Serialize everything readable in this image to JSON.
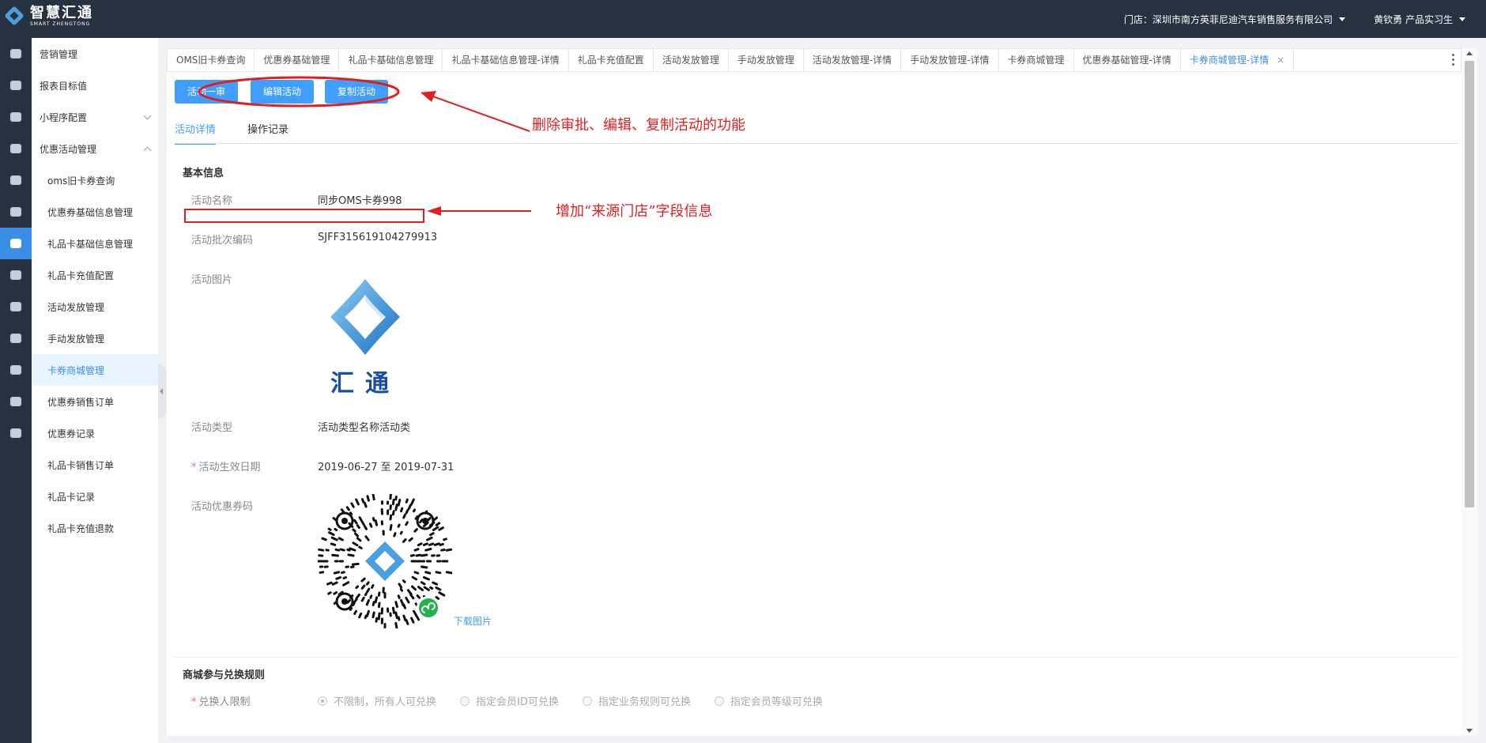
{
  "header": {
    "logo_cn": "智慧汇通",
    "logo_en": "SMART ZHENGTONG",
    "store": "门店：深圳市南方英菲尼迪汽车销售服务有限公司",
    "user": "黄钦勇 产品实习生"
  },
  "rail": {
    "icons": [
      "users-icon",
      "car-icon",
      "gear-icon",
      "shield-icon",
      "crown-icon",
      "database-icon",
      "ticket-icon",
      "calendar-icon",
      "pie-chart-icon",
      "cube-icon",
      "briefcase-icon",
      "person-icon",
      "printer-icon"
    ],
    "active_index": 6
  },
  "menu": {
    "items": [
      {
        "label": "营销管理",
        "level": 0
      },
      {
        "label": "报表目标值",
        "level": 0
      },
      {
        "label": "小程序配置",
        "level": 0,
        "chevron": "down"
      },
      {
        "label": "优惠活动管理",
        "level": 0,
        "chevron": "up"
      },
      {
        "label": "oms旧卡券查询",
        "level": 1
      },
      {
        "label": "优惠券基础信息管理",
        "level": 1
      },
      {
        "label": "礼品卡基础信息管理",
        "level": 1
      },
      {
        "label": "礼品卡充值配置",
        "level": 1
      },
      {
        "label": "活动发放管理",
        "level": 1
      },
      {
        "label": "手动发放管理",
        "level": 1
      },
      {
        "label": "卡券商城管理",
        "level": 1,
        "active": true
      },
      {
        "label": "优惠券销售订单",
        "level": 1
      },
      {
        "label": "优惠券记录",
        "level": 1
      },
      {
        "label": "礼品卡销售订单",
        "level": 1
      },
      {
        "label": "礼品卡记录",
        "level": 1
      },
      {
        "label": "礼品卡充值退款",
        "level": 1
      }
    ]
  },
  "tabs": [
    {
      "label": "OMS旧卡券查询"
    },
    {
      "label": "优惠券基础管理"
    },
    {
      "label": "礼品卡基础信息管理"
    },
    {
      "label": "礼品卡基础信息管理-详情"
    },
    {
      "label": "礼品卡充值配置"
    },
    {
      "label": "活动发放管理"
    },
    {
      "label": "手动发放管理"
    },
    {
      "label": "活动发放管理-详情"
    },
    {
      "label": "手动发放管理-详情"
    },
    {
      "label": "卡券商城管理"
    },
    {
      "label": "优惠券基础管理-详情"
    },
    {
      "label": "卡券商城管理-详情",
      "active": true,
      "close": "×"
    }
  ],
  "actions": {
    "approve": "活动一审",
    "edit": "编辑活动",
    "copy": "复制活动"
  },
  "subtabs": {
    "detail": "活动详情",
    "log": "操作记录"
  },
  "basic": {
    "title": "基本信息",
    "name_label": "活动名称",
    "name_value": "同步OMS卡券998",
    "batch_label": "活动批次编码",
    "batch_value": "SJFF315619104279913",
    "image_label": "活动图片",
    "image_caption": "汇通",
    "type_label": "活动类型",
    "type_value": "活动类型名称活动类",
    "date_label": "活动生效日期",
    "date_required": "*",
    "date_value": "2019-06-27 至 2019-07-31",
    "qr_label": "活动优惠券码",
    "download": "下载图片"
  },
  "rules": {
    "title": "商城参与兑换规则",
    "limit_label": "兑换人限制",
    "limit_required": "*",
    "options": [
      {
        "label": "不限制，所有人可兑换",
        "checked": true
      },
      {
        "label": "指定会员ID可兑换",
        "checked": false
      },
      {
        "label": "指定业务规则可兑换",
        "checked": false
      },
      {
        "label": "指定会员等级可兑换",
        "checked": false
      }
    ]
  },
  "annotations": {
    "note1": "删除审批、编辑、复制活动的功能",
    "note2": "增加“来源门店”字段信息",
    "color": "#e02020"
  }
}
